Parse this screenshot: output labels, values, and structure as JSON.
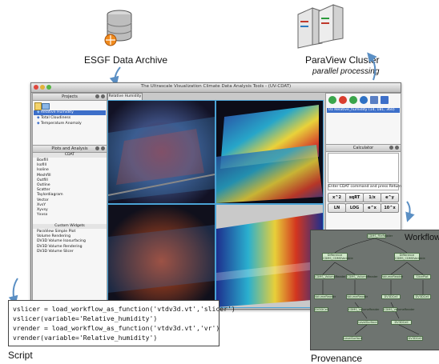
{
  "labels": {
    "esgf": "ESGF Data Archive",
    "paraview": "ParaView Cluster",
    "paraview_sub": "parallel processing",
    "workflow": "Workflow",
    "provenance": "Provenance",
    "script": "Script"
  },
  "window": {
    "title": "The Ultrascale Visualization Climate Data Analysis Tools - (UV-CDAT)",
    "tab": "Relative Humidity"
  },
  "projects": {
    "header": "Projects",
    "items": [
      "Relative Humidity",
      "Total Cloudiness",
      "Temperature Anomaly"
    ],
    "selected_index": 0
  },
  "plots": {
    "header": "Plots and Analysis",
    "group_cdat": "CDAT",
    "cdat_items": [
      "Boxfill",
      "Isofill",
      "Isoline",
      "Meshfill",
      "Outfill",
      "Outline",
      "Scatter",
      "Taylordiagram",
      "Vector",
      "XvsY",
      "Xyvsy",
      "Yxvsx"
    ],
    "group_custom": "Custom Widgets",
    "custom_items": [
      "ParaView Simple Plot",
      "Volume Rendering",
      "DV3D Volume Isosurfacing",
      "DV3D Volume Rendering",
      "DV3D Volume Slicer"
    ]
  },
  "variables": {
    "selected": "01 Relative_humidity (14, 181, 360)"
  },
  "calculator": {
    "header": "Calculator",
    "prompt": "Enter CDAT command and press Return",
    "row1": [
      "x^2",
      "sqRT",
      "1/x",
      "e^y"
    ],
    "row2": [
      "LN",
      "LOG",
      "e^x",
      "10^x"
    ]
  },
  "workflow_nodes": [
    "CDMS_FileReader",
    "Difference\nCDMS_CDMSVariable",
    "Difference\nCDMS_CDMSVariable",
    "CDMS_VolumeReader",
    "CDMS_VolumeReader",
    "VolumeReader",
    "SlicePlot",
    "VolumeReader",
    "VolumeReader",
    "DV3DCell",
    "DV3DCell",
    "DV3DCell",
    "CDMS_VolumeReader",
    "CDMS_VolumeReader",
    "LevelSurface",
    "DV3DCell",
    "LevelSurface",
    "DV3DCell"
  ],
  "script_lines": [
    "vslicer = load_workflow_as_function('vtdv3d.vt','slicer')",
    "vslicer(variable='Relative_humidity')",
    "vrender = load_workflow_as_function('vtdv3d.vt','vr')",
    "vrender(variable='Relative_humidity')"
  ],
  "colors": {
    "selection": "#3d6fc9",
    "workflow_node": "#cfe6c8",
    "workflow_bg": "#6e7470"
  }
}
